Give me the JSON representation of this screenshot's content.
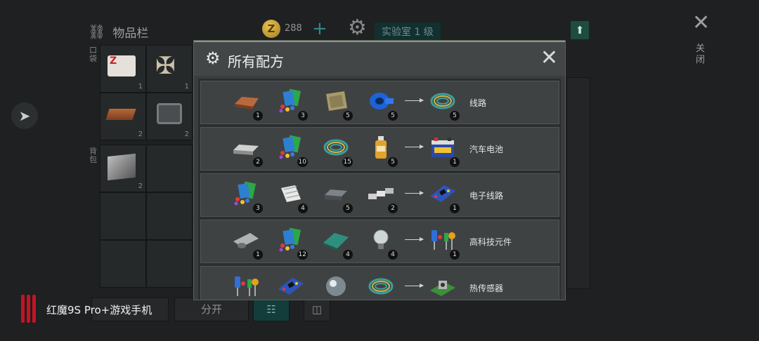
{
  "inventory": {
    "title": "物品栏",
    "side_tab_top": "口袋",
    "side_tab_bottom": "背包"
  },
  "currency": {
    "amount": "288"
  },
  "lab": {
    "label": "实验室 1 级"
  },
  "close": {
    "label": "关闭"
  },
  "bottom_buttons": {
    "split": "分开"
  },
  "brand": {
    "text": "红魔9S Pro+游戏手机",
    "color": "#c41422"
  },
  "modal": {
    "title": "所有配方",
    "recipes": [
      {
        "result_name": "线路",
        "ingredients": [
          {
            "icon": "copper-ingot-icon",
            "count": "1"
          },
          {
            "icon": "plastic-parts-icon",
            "count": "3"
          },
          {
            "icon": "cloth-icon",
            "count": "5"
          },
          {
            "icon": "tape-icon",
            "count": "5"
          }
        ],
        "result": {
          "icon": "wire-coil-icon",
          "count": "5"
        }
      },
      {
        "result_name": "汽车电池",
        "ingredients": [
          {
            "icon": "steel-bar-icon",
            "count": "2"
          },
          {
            "icon": "plastic-parts-icon",
            "count": "10"
          },
          {
            "icon": "wire-coil-icon",
            "count": "15"
          },
          {
            "icon": "acid-bottle-icon",
            "count": "5"
          }
        ],
        "result": {
          "icon": "car-battery-icon",
          "count": "1"
        }
      },
      {
        "result_name": "电子线路",
        "ingredients": [
          {
            "icon": "plastic-parts-icon",
            "count": "3"
          },
          {
            "icon": "fabric-roll-icon",
            "count": "4"
          },
          {
            "icon": "iron-ingot-icon",
            "count": "5"
          },
          {
            "icon": "aluminium-bars-icon",
            "count": "2"
          }
        ],
        "result": {
          "icon": "circuit-board-icon",
          "count": "1"
        }
      },
      {
        "result_name": "高科技元件",
        "ingredients": [
          {
            "icon": "metal-sheet-roll-icon",
            "count": "1"
          },
          {
            "icon": "plastic-parts-icon",
            "count": "12"
          },
          {
            "icon": "glass-sheet-icon",
            "count": "4"
          },
          {
            "icon": "light-bulb-icon",
            "count": "4"
          }
        ],
        "result": {
          "icon": "hi-tech-components-icon",
          "count": "1"
        }
      },
      {
        "result_name": "热传感器",
        "ingredients": [
          {
            "icon": "hi-tech-components-icon",
            "count": ""
          },
          {
            "icon": "circuit-board-icon",
            "count": ""
          },
          {
            "icon": "lens-icon",
            "count": ""
          },
          {
            "icon": "wire-coil-icon",
            "count": ""
          }
        ],
        "result": {
          "icon": "heat-sensor-icon",
          "count": ""
        }
      }
    ]
  }
}
